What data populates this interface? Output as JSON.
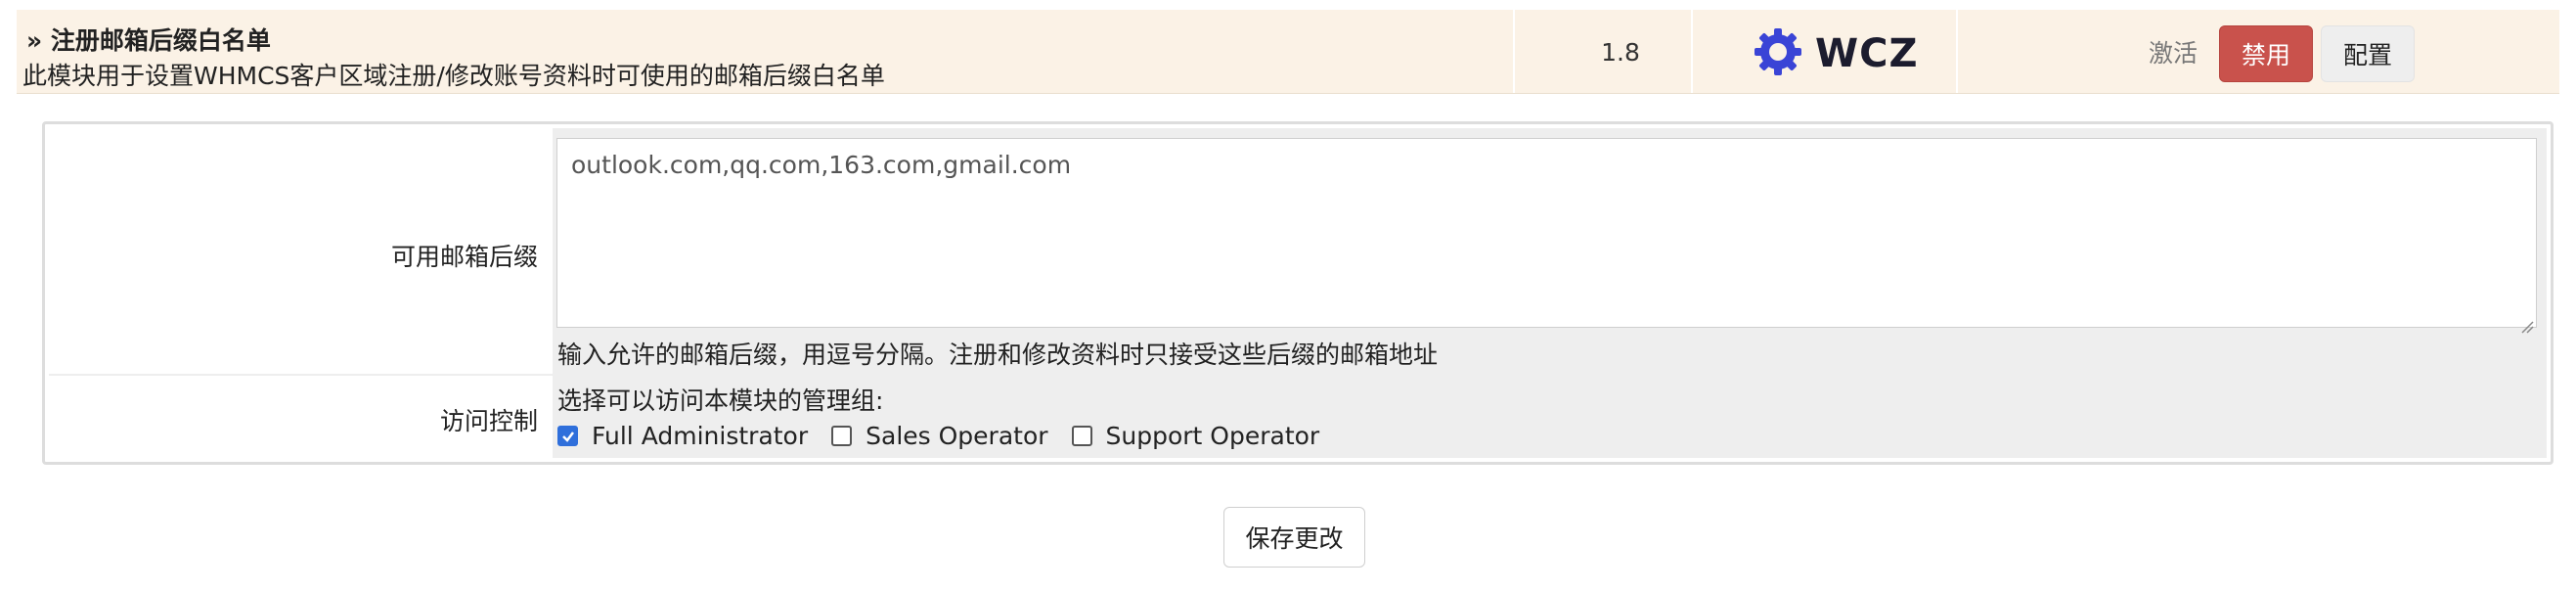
{
  "module": {
    "title": "» 注册邮箱后缀白名单",
    "description": "此模块用于设置WHMCS客户区域注册/修改账号资料时可使用的邮箱后缀白名单",
    "version": "1.8",
    "logo_text": "WCZ",
    "status_label": "激活",
    "disable_label": "禁用",
    "config_label": "配置"
  },
  "settings": {
    "suffix_label": "可用邮箱后缀",
    "suffix_value": "outlook.com,qq.com,163.com,gmail.com",
    "suffix_hint": "输入允许的邮箱后缀，用逗号分隔。注册和修改资料时只接受这些后缀的邮箱地址",
    "access_label": "访问控制",
    "access_prompt": "选择可以访问本模块的管理组:",
    "groups": [
      {
        "label": "Full Administrator",
        "checked": true
      },
      {
        "label": "Sales Operator",
        "checked": false
      },
      {
        "label": "Support Operator",
        "checked": false
      }
    ]
  },
  "save_label": "保存更改",
  "colors": {
    "row_bg": "#fbf2e6",
    "danger": "#c9524c",
    "checkbox_active": "#2f6fdb",
    "logo": "#3a44d6"
  }
}
